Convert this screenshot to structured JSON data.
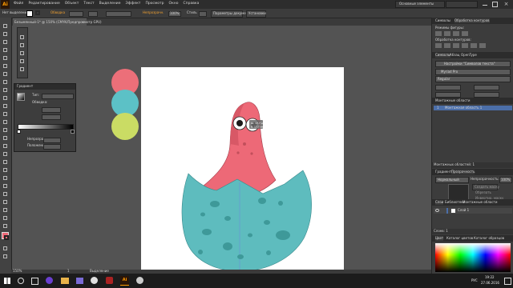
{
  "app": {
    "logo": "Ai",
    "menu": [
      "Файл",
      "Редактирование",
      "Объект",
      "Текст",
      "Выделение",
      "Эффект",
      "Просмотр",
      "Окно",
      "Справка"
    ],
    "workspace": "Основные элементы"
  },
  "control_bar": {
    "selection_label": "Нет выделения",
    "stroke_label": "Обводка",
    "style_label": "Стиль",
    "opacity_label": "Непрозрачн.",
    "opacity_value": "100%",
    "doc_settings": "Параметры документа",
    "prefs": "Установки"
  },
  "document": {
    "tab_title": "Безымянный-1* @ 150% (CMYK/Предпросмотр GPU)"
  },
  "gradient_panel": {
    "title": "Градиент",
    "type_label": "Тип:",
    "stroke_label": "Обводка:",
    "opacity_label": "Непрозрачн.:",
    "location_label": "Положение:"
  },
  "canvas": {
    "measure_line1": "Ш: 17,7 мм",
    "measure_line2": "В: 17,7 мм"
  },
  "right_panel": {
    "top_tabs": [
      "Символы",
      "Обработка контуров"
    ],
    "pathfinder_modes_label": "Режимы фигуры:",
    "pathfinder_label": "Обработка контуров:",
    "char_tabs": [
      "Символы",
      "Абзац",
      "OpenType"
    ],
    "search_placeholder": "Настройки \"Символов текста\"",
    "font_name": "Myriad Pro",
    "font_style": "Regular",
    "artboards_title": "Монтажные области",
    "artboard_index": "1",
    "artboard_name": "Монтажная область 1",
    "artboards_footer": "Монтажных областей: 1",
    "transparency_tabs": [
      "Градиент",
      "Прозрачность"
    ],
    "blend_mode": "Нормальный",
    "opacity_label": "Непрозрачность:",
    "opacity_value": "100%",
    "make_mask": "Создать маску",
    "clip": "Обрезать",
    "invert_mask": "Инвертир. маску",
    "layers_tabs": [
      "Слои",
      "Библиотеки",
      "Монтажные области"
    ],
    "layer_name": "Слой 1",
    "layers_footer": "Слоев: 1",
    "color_tabs": [
      "Цвет",
      "Каталог цветов",
      "Каталог образцов"
    ]
  },
  "statusbar": {
    "zoom": "150%",
    "page": "1",
    "tool": "Выделение"
  },
  "taskbar": {
    "lang": "РУС",
    "time": "19:22",
    "date": "27.06.2016"
  },
  "colors": {
    "swatch_pink": "#ec6f79",
    "swatch_teal": "#5cc1c6",
    "swatch_lime": "#cadc64",
    "body_pink": "#ed6977",
    "shell_teal": "#5ebcbe",
    "spot_teal": "#3e9999"
  }
}
